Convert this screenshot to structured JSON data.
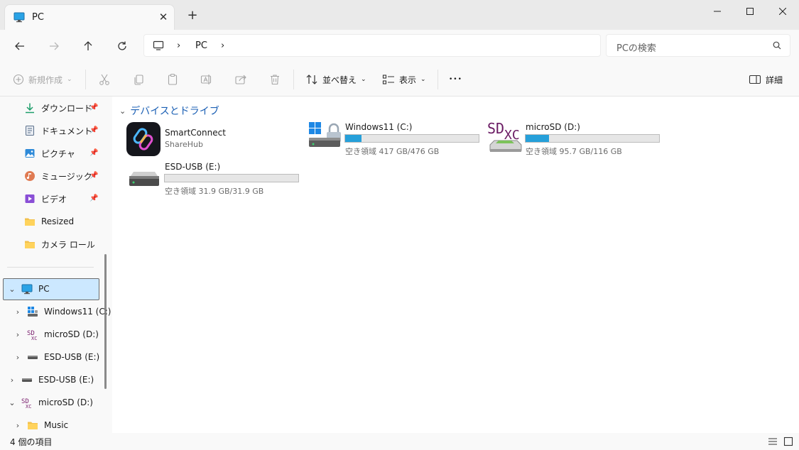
{
  "window": {
    "tab_title": "PC",
    "new_tab_symbol": "+",
    "close_tab_symbol": "✕"
  },
  "address": {
    "segments": [
      "PC"
    ],
    "search_placeholder": "PCの検索"
  },
  "commands": {
    "new": "新規作成",
    "sort": "並べ替え",
    "view": "表示",
    "more": "•••",
    "details": "詳細"
  },
  "sidebar": {
    "quick_access": [
      {
        "label": "ダウンロード",
        "icon": "download-icon",
        "pinned": true
      },
      {
        "label": "ドキュメント",
        "icon": "document-icon",
        "pinned": true
      },
      {
        "label": "ピクチャ",
        "icon": "pictures-icon",
        "pinned": true
      },
      {
        "label": "ミュージック",
        "icon": "music-icon",
        "pinned": true
      },
      {
        "label": "ビデオ",
        "icon": "video-icon",
        "pinned": true
      },
      {
        "label": "Resized",
        "icon": "folder-icon",
        "pinned": false
      },
      {
        "label": "カメラ ロール",
        "icon": "folder-icon",
        "pinned": false
      }
    ],
    "tree": [
      {
        "label": "PC",
        "expanded": true,
        "selected": true
      },
      {
        "label": "Windows11 (C:)"
      },
      {
        "label": "microSD (D:)"
      },
      {
        "label": "ESD-USB (E:)"
      },
      {
        "label": "ESD-USB (E:)"
      },
      {
        "label": "microSD (D:)",
        "expanded": true
      },
      {
        "label": "Music"
      }
    ]
  },
  "main": {
    "group_title": "デバイスとドライブ",
    "items": [
      {
        "name": "SmartConnect",
        "sub": "ShareHub",
        "type": "app"
      },
      {
        "name": "Windows11 (C:)",
        "sub": "空き領域 417 GB/476 GB",
        "used_fraction": 0.124
      },
      {
        "name": "microSD (D:)",
        "sub": "空き領域 95.7 GB/116 GB",
        "used_fraction": 0.175
      },
      {
        "name": "ESD-USB (E:)",
        "sub": "空き領域 31.9 GB/31.9 GB",
        "used_fraction": 0.0
      }
    ],
    "sdxc_logo": {
      "sd": "SD",
      "xc": "XC"
    }
  },
  "status": {
    "item_count": "4 個の項目"
  },
  "colors": {
    "accent": "#26a0da",
    "selection": "#cce8ff",
    "group_header": "#1a5fb4"
  }
}
